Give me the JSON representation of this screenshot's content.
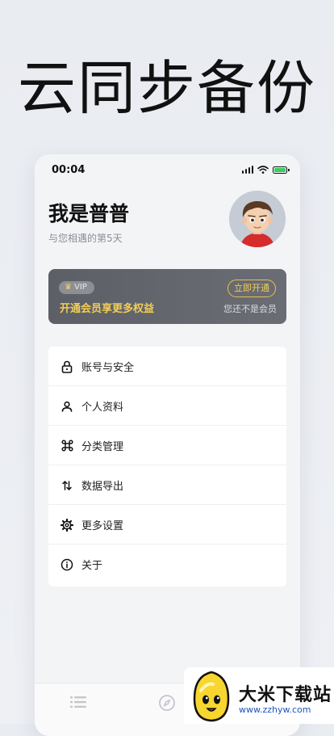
{
  "promo": {
    "title": "云同步备份"
  },
  "status_bar": {
    "time": "00:04",
    "icons": [
      "signal-icon",
      "wifi-icon",
      "battery-charging-icon"
    ]
  },
  "profile": {
    "name": "我是普普",
    "subtitle": "与您相遇的第5天",
    "avatar": "avatar-boy-cartoon"
  },
  "vip": {
    "badge": "VIP",
    "promo_text": "开通会员享更多权益",
    "button_label": "立即开通",
    "status_text": "您还不是会员",
    "accent_color": "#f2cd55"
  },
  "menu": {
    "items": [
      {
        "label": "账号与安全",
        "icon": "lock-icon"
      },
      {
        "label": "个人资料",
        "icon": "user-icon"
      },
      {
        "label": "分类管理",
        "icon": "command-icon"
      },
      {
        "label": "数据导出",
        "icon": "swap-vertical-icon"
      },
      {
        "label": "更多设置",
        "icon": "gear-icon"
      },
      {
        "label": "关于",
        "icon": "info-icon"
      }
    ]
  },
  "tabbar": {
    "icons": [
      "list-icon",
      "compass-icon"
    ]
  },
  "watermark": {
    "title": "大米下载站",
    "url": "www.zzhyw.com"
  }
}
